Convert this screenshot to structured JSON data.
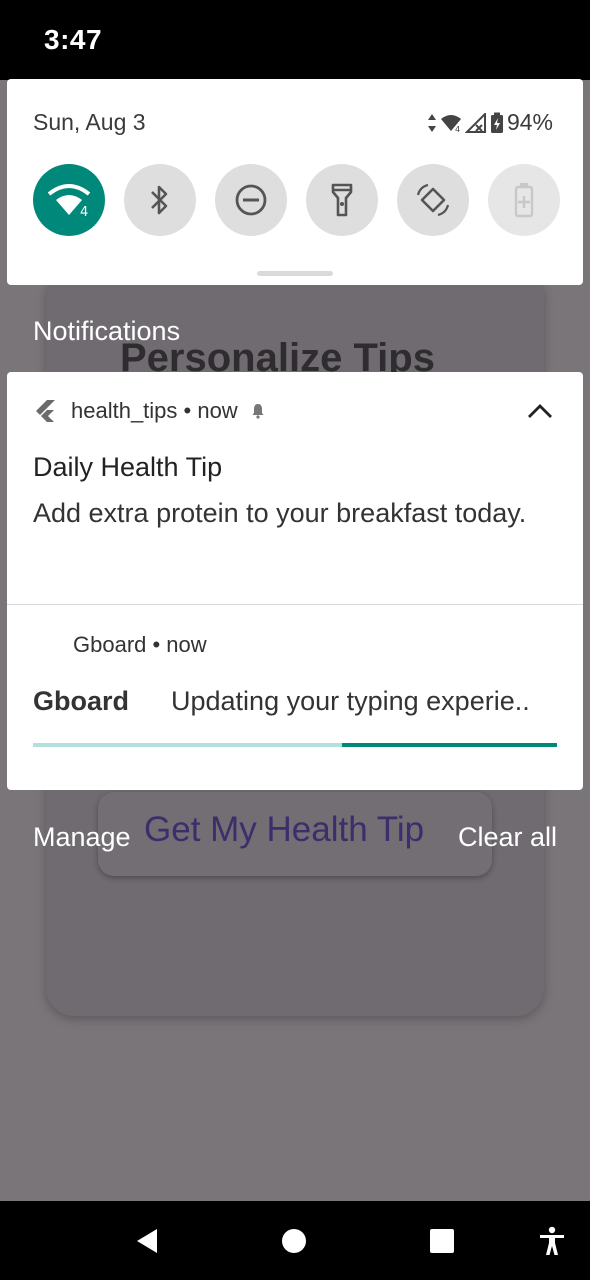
{
  "status_bar": {
    "time": "3:47"
  },
  "quick_settings": {
    "date": "Sun, Aug 3",
    "battery_percent": "94%",
    "wifi_badge": "4",
    "tiles": [
      {
        "icon": "wifi-icon",
        "active": true
      },
      {
        "icon": "bluetooth-icon",
        "active": false
      },
      {
        "icon": "do-not-disturb-icon",
        "active": false
      },
      {
        "icon": "flashlight-icon",
        "active": false
      },
      {
        "icon": "auto-rotate-icon",
        "active": false
      },
      {
        "icon": "battery-saver-icon",
        "active": false
      }
    ]
  },
  "background_app": {
    "title": "Personalize Tips",
    "button_label": "Get My Health Tip"
  },
  "notifications": {
    "heading": "Notifications",
    "items": [
      {
        "app_line": "health_tips • now",
        "title": "Daily Health Tip",
        "text": "Add extra protein to your breakfast today."
      },
      {
        "app_line": "Gboard • now",
        "title": "Gboard",
        "text": "Updating your typing experie..",
        "progress": 0.41
      }
    ],
    "manage_label": "Manage",
    "clear_all_label": "Clear all"
  },
  "colors": {
    "accent": "#00897b",
    "progress_track": "#b3dfdc",
    "scrim": "#7a7579"
  },
  "nav_bar": {
    "icons": [
      "back-icon",
      "home-icon",
      "recents-icon",
      "accessibility-icon"
    ]
  }
}
